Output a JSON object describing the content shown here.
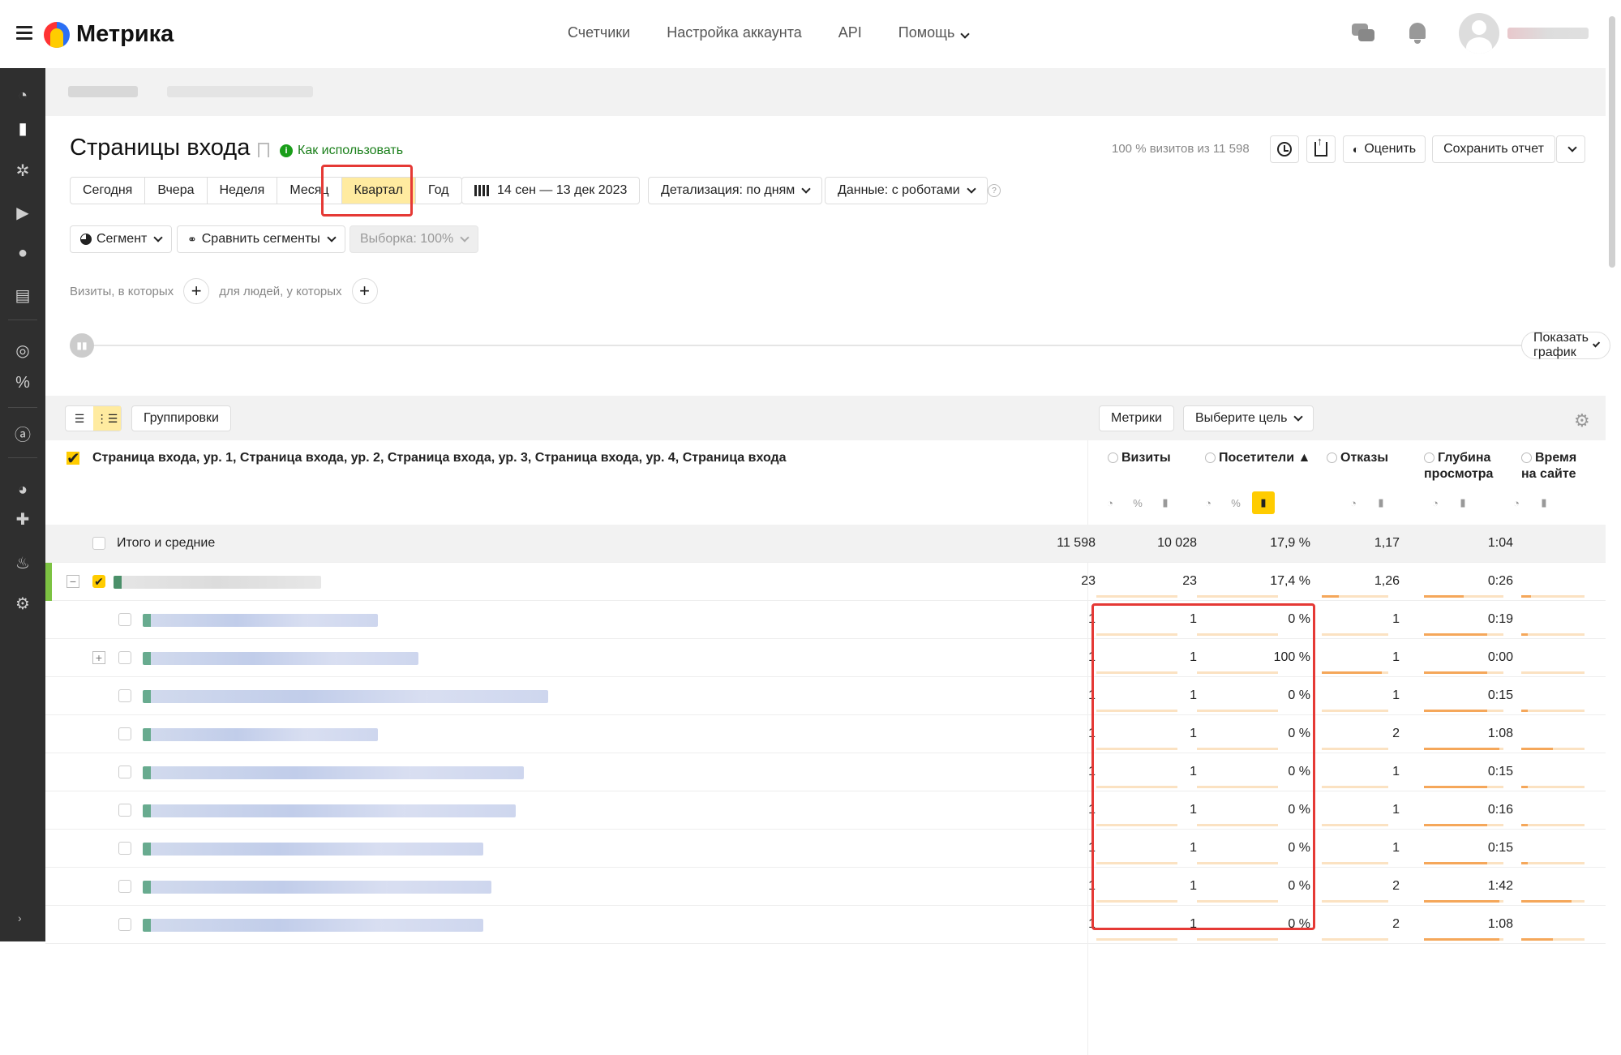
{
  "app": {
    "name": "Метрика"
  },
  "topnav": [
    "Счетчики",
    "Настройка аккаунта",
    "API",
    "Помощь"
  ],
  "page": {
    "title": "Страницы входа",
    "howto": "Как использовать",
    "visits_share": "100 % визитов из 11 598",
    "rate_label": "Оценить",
    "save_report_label": "Сохранить отчет"
  },
  "periods": [
    "Сегодня",
    "Вчера",
    "Неделя",
    "Месяц",
    "Квартал",
    "Год"
  ],
  "active_period": "Квартал",
  "date_range": "14 сен — 13 дек 2023",
  "detail_label": "Детализация: по дням",
  "data_label": "Данные: с роботами",
  "segment": {
    "segment_label": "Сегмент",
    "compare_label": "Сравнить сегменты",
    "sample_label": "Выборка: 100%"
  },
  "conditions": {
    "visits_label": "Визиты, в которых",
    "people_label": "для людей, у которых"
  },
  "show_graph_label": "Показать график",
  "table_toolbar": {
    "groupings_label": "Группировки",
    "metrics_label": "Метрики",
    "goal_label": "Выберите цель"
  },
  "table": {
    "dimensions_title": "Страница входа, ур. 1, Страница входа, ур. 2, Страница входа, ур. 3, Страница входа, ур. 4, Страница входа",
    "columns": [
      "Визиты",
      "Посетители ▲",
      "Отказы",
      "Глубина просмотра",
      "Время на сайте"
    ],
    "col_lines": [
      [
        "Визиты"
      ],
      [
        "Посетители ▲"
      ],
      [
        "Отказы"
      ],
      [
        "Глубина",
        "просмотра"
      ],
      [
        "Время",
        "на сайте"
      ]
    ],
    "sort_column": "Посетители",
    "total_label": "Итого и средние",
    "total": [
      "11 598",
      "10 028",
      "17,9 %",
      "1,17",
      "1:04"
    ],
    "rows": [
      {
        "values": [
          "23",
          "23",
          "17,4 %",
          "1,26",
          "0:26"
        ],
        "level": 0,
        "bars": [
          0.0,
          0.0,
          0.25,
          0.5,
          0.15
        ]
      },
      {
        "values": [
          "1",
          "1",
          "0 %",
          "1",
          "0:19"
        ],
        "level": 1,
        "bars": [
          0.0,
          0.0,
          0.0,
          0.8,
          0.1
        ]
      },
      {
        "values": [
          "1",
          "1",
          "100 %",
          "1",
          "0:00"
        ],
        "level": 1,
        "bars": [
          0.0,
          0.0,
          0.9,
          0.8,
          0.0
        ]
      },
      {
        "values": [
          "1",
          "1",
          "0 %",
          "1",
          "0:15"
        ],
        "level": 1,
        "bars": [
          0.0,
          0.0,
          0.0,
          0.8,
          0.1
        ]
      },
      {
        "values": [
          "1",
          "1",
          "0 %",
          "2",
          "1:08"
        ],
        "level": 1,
        "bars": [
          0.0,
          0.0,
          0.0,
          0.95,
          0.5
        ]
      },
      {
        "values": [
          "1",
          "1",
          "0 %",
          "1",
          "0:15"
        ],
        "level": 1,
        "bars": [
          0.0,
          0.0,
          0.0,
          0.8,
          0.1
        ]
      },
      {
        "values": [
          "1",
          "1",
          "0 %",
          "1",
          "0:16"
        ],
        "level": 1,
        "bars": [
          0.0,
          0.0,
          0.0,
          0.8,
          0.1
        ]
      },
      {
        "values": [
          "1",
          "1",
          "0 %",
          "1",
          "0:15"
        ],
        "level": 1,
        "bars": [
          0.0,
          0.0,
          0.0,
          0.8,
          0.1
        ]
      },
      {
        "values": [
          "1",
          "1",
          "0 %",
          "2",
          "1:42"
        ],
        "level": 1,
        "bars": [
          0.0,
          0.0,
          0.0,
          0.95,
          0.8
        ]
      },
      {
        "values": [
          "1",
          "1",
          "0 %",
          "2",
          "1:08"
        ],
        "level": 1,
        "bars": [
          0.0,
          0.0,
          0.0,
          0.95,
          0.5
        ]
      }
    ]
  },
  "colors": {
    "accent": "#ffcc00",
    "highlight": "#e53935",
    "link": "#1a7f1a",
    "sidebar": "#2f2f2f"
  }
}
